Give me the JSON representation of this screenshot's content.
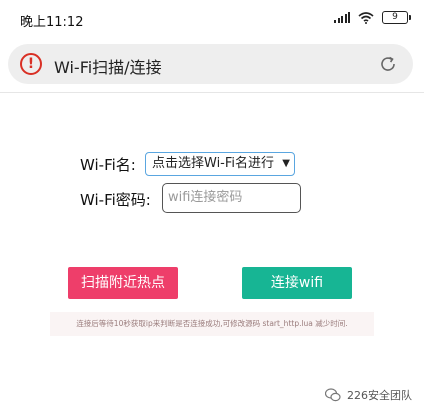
{
  "status_bar": {
    "time": "晚上11:12",
    "battery": "9",
    "icons": [
      "signal-icon",
      "wifi-icon",
      "battery-icon"
    ]
  },
  "address_bar": {
    "title": "Wi-Fi扫描/连接",
    "warning_icon": "warning-icon",
    "reload_icon": "reload-icon"
  },
  "form": {
    "ssid_label": "Wi-Fi名:",
    "ssid_selected": "点击选择Wi-Fi名进行",
    "password_label": "Wi-Fi密码:",
    "password_placeholder": "wifi连接密码"
  },
  "buttons": {
    "scan_label": "扫描附近热点",
    "connect_label": "连接wifi"
  },
  "hint": "连接后等待10秒获取ip来判断是否连接成功,可修改源码 start_http.lua 减少时间.",
  "watermark": {
    "text": "226安全团队"
  },
  "colors": {
    "scan_button": "#ee3e6a",
    "connect_button": "#17b594",
    "warning": "#d93025",
    "select_border": "#5aa6e0"
  }
}
